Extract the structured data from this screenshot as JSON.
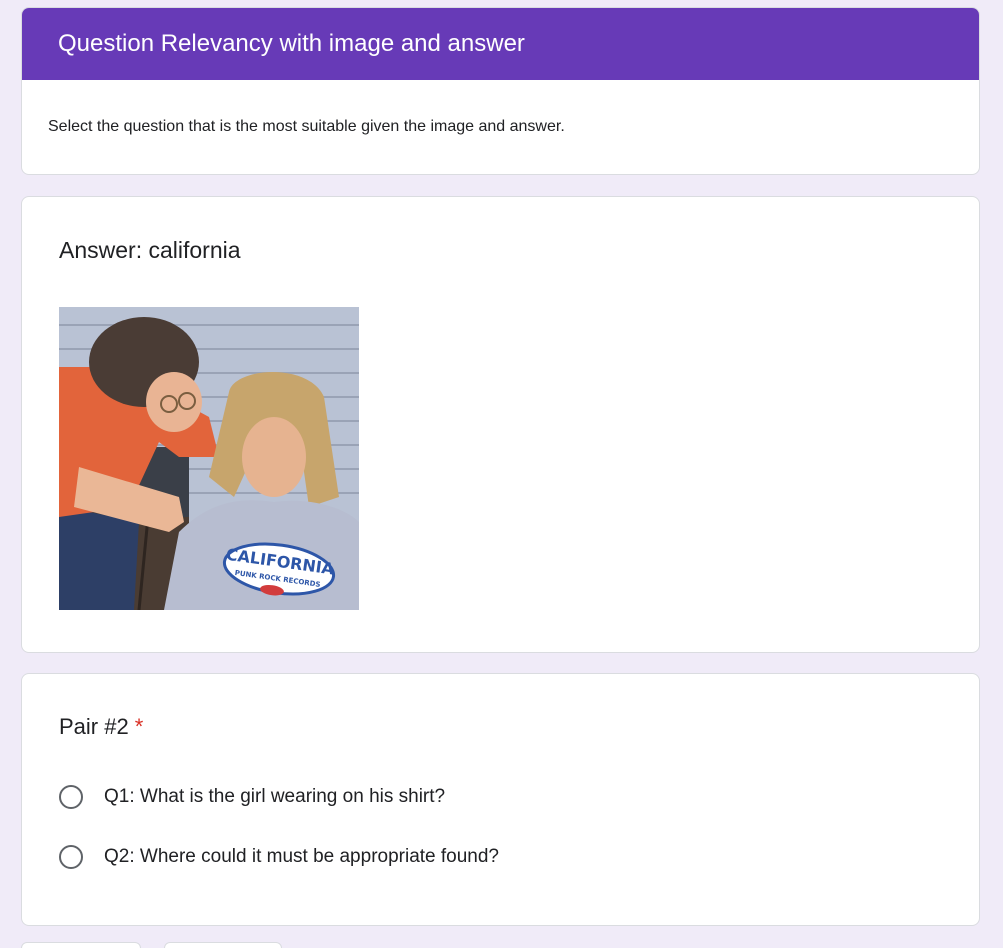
{
  "form": {
    "title": "Question Relevancy with image and answer",
    "description": "Select the question that is the most suitable given the image and answer.",
    "accent_color": "#673ab7",
    "background_color": "#f0ebf8"
  },
  "image_section": {
    "answer_label": "Answer: california",
    "shirt_text": "CALIFORNIA",
    "shirt_subtext": "PUNK ROCK RECORDS"
  },
  "question": {
    "title": "Pair #2",
    "required_mark": "*",
    "options": [
      {
        "label": "Q1: What is the girl wearing on his shirt?"
      },
      {
        "label": "Q2: Where could it must be appropriate found?"
      }
    ]
  }
}
